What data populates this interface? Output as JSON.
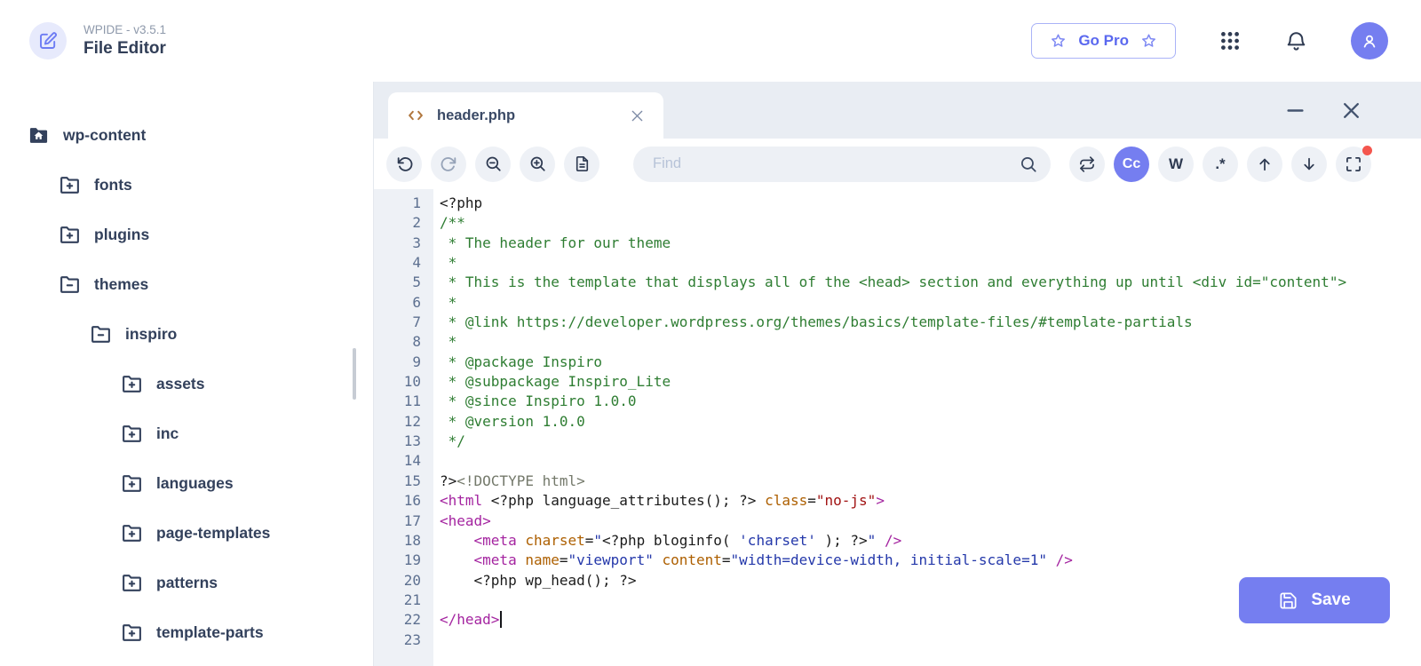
{
  "app": {
    "accent_color": "#757ef0",
    "notification_color": "#f4564e",
    "icon_color": "#2f3b52",
    "tab_icon_color": "#b0763d"
  },
  "header": {
    "brand_version": "WPIDE - v3.5.1",
    "brand_title": "File Editor",
    "go_pro_label": "Go Pro"
  },
  "sidebar": {
    "tree": [
      {
        "label": "wp-content",
        "icon": "home-folder-icon",
        "depth": 0,
        "expanded": true
      },
      {
        "label": "fonts",
        "icon": "folder-plus-icon",
        "depth": 1,
        "expanded": false
      },
      {
        "label": "plugins",
        "icon": "folder-plus-icon",
        "depth": 1,
        "expanded": false
      },
      {
        "label": "themes",
        "icon": "folder-minus-icon",
        "depth": 1,
        "expanded": true
      },
      {
        "label": "inspiro",
        "icon": "folder-minus-icon",
        "depth": 2,
        "expanded": true
      },
      {
        "label": "assets",
        "icon": "folder-plus-icon",
        "depth": 3,
        "expanded": false
      },
      {
        "label": "inc",
        "icon": "folder-plus-icon",
        "depth": 3,
        "expanded": false
      },
      {
        "label": "languages",
        "icon": "folder-plus-icon",
        "depth": 3,
        "expanded": false
      },
      {
        "label": "page-templates",
        "icon": "folder-plus-icon",
        "depth": 3,
        "expanded": false
      },
      {
        "label": "patterns",
        "icon": "folder-plus-icon",
        "depth": 3,
        "expanded": false
      },
      {
        "label": "template-parts",
        "icon": "folder-plus-icon",
        "depth": 3,
        "expanded": false
      }
    ]
  },
  "editor": {
    "tab": {
      "label": "header.php"
    },
    "toolbar": {
      "find_placeholder": "Find",
      "match_case_label": "Cc",
      "whole_word_label": "W",
      "regex_label": ".*"
    },
    "save_label": "Save",
    "code": {
      "token_colors": {
        "plain": "#1b1b1b",
        "cm": "#2e7d32",
        "tag": "#a424a0",
        "attr": "#ad5f00",
        "str": "#2438aa",
        "str2": "#a11212",
        "meta": "#74796b"
      },
      "lines": [
        {
          "num": 1,
          "tokens": [
            {
              "t": "<?php",
              "c": "plain"
            }
          ]
        },
        {
          "num": 2,
          "tokens": [
            {
              "t": "/**",
              "c": "cm"
            }
          ]
        },
        {
          "num": 3,
          "tokens": [
            {
              "t": " * The header for our theme",
              "c": "cm"
            }
          ]
        },
        {
          "num": 4,
          "tokens": [
            {
              "t": " *",
              "c": "cm"
            }
          ]
        },
        {
          "num": 5,
          "tokens": [
            {
              "t": " * This is the template that displays all of the <head> section and everything up until <div id=\"content\">",
              "c": "cm"
            }
          ]
        },
        {
          "num": 6,
          "tokens": [
            {
              "t": " *",
              "c": "cm"
            }
          ]
        },
        {
          "num": 7,
          "tokens": [
            {
              "t": " * @link https://developer.wordpress.org/themes/basics/template-files/#template-partials",
              "c": "cm"
            }
          ]
        },
        {
          "num": 8,
          "tokens": [
            {
              "t": " *",
              "c": "cm"
            }
          ]
        },
        {
          "num": 9,
          "tokens": [
            {
              "t": " * @package Inspiro",
              "c": "cm"
            }
          ]
        },
        {
          "num": 10,
          "tokens": [
            {
              "t": " * @subpackage Inspiro_Lite",
              "c": "cm"
            }
          ]
        },
        {
          "num": 11,
          "tokens": [
            {
              "t": " * @since Inspiro 1.0.0",
              "c": "cm"
            }
          ]
        },
        {
          "num": 12,
          "tokens": [
            {
              "t": " * @version 1.0.0",
              "c": "cm"
            }
          ]
        },
        {
          "num": 13,
          "tokens": [
            {
              "t": " */",
              "c": "cm"
            }
          ]
        },
        {
          "num": 14,
          "tokens": []
        },
        {
          "num": 15,
          "tokens": [
            {
              "t": "?>",
              "c": "plain"
            },
            {
              "t": "<!DOCTYPE html>",
              "c": "meta"
            }
          ]
        },
        {
          "num": 16,
          "tokens": [
            {
              "t": "<html ",
              "c": "tag"
            },
            {
              "t": "<?php language_attributes(); ?>",
              "c": "plain"
            },
            {
              "t": " ",
              "c": "plain"
            },
            {
              "t": "class",
              "c": "attr"
            },
            {
              "t": "=",
              "c": "plain"
            },
            {
              "t": "\"no-js\"",
              "c": "str2"
            },
            {
              "t": ">",
              "c": "tag"
            }
          ]
        },
        {
          "num": 17,
          "tokens": [
            {
              "t": "<head>",
              "c": "tag"
            }
          ]
        },
        {
          "num": 18,
          "tokens": [
            {
              "t": "    ",
              "c": "plain"
            },
            {
              "t": "<meta ",
              "c": "tag"
            },
            {
              "t": "charset",
              "c": "attr"
            },
            {
              "t": "=",
              "c": "plain"
            },
            {
              "t": "\"",
              "c": "str"
            },
            {
              "t": "<?php bloginfo( ",
              "c": "plain"
            },
            {
              "t": "'charset'",
              "c": "str"
            },
            {
              "t": " ); ?>",
              "c": "plain"
            },
            {
              "t": "\"",
              "c": "str"
            },
            {
              "t": " ",
              "c": "plain"
            },
            {
              "t": "/>",
              "c": "tag"
            }
          ]
        },
        {
          "num": 19,
          "tokens": [
            {
              "t": "    ",
              "c": "plain"
            },
            {
              "t": "<meta ",
              "c": "tag"
            },
            {
              "t": "name",
              "c": "attr"
            },
            {
              "t": "=",
              "c": "plain"
            },
            {
              "t": "\"viewport\"",
              "c": "str"
            },
            {
              "t": " ",
              "c": "plain"
            },
            {
              "t": "content",
              "c": "attr"
            },
            {
              "t": "=",
              "c": "plain"
            },
            {
              "t": "\"width=device-width, initial-scale=1\"",
              "c": "str"
            },
            {
              "t": " ",
              "c": "plain"
            },
            {
              "t": "/>",
              "c": "tag"
            }
          ]
        },
        {
          "num": 20,
          "tokens": [
            {
              "t": "    <?php wp_head(); ?>",
              "c": "plain"
            }
          ]
        },
        {
          "num": 21,
          "tokens": []
        },
        {
          "num": 22,
          "tokens": [
            {
              "t": "</head>",
              "c": "tag"
            }
          ],
          "cursor": true
        },
        {
          "num": 23,
          "tokens": []
        }
      ]
    }
  }
}
